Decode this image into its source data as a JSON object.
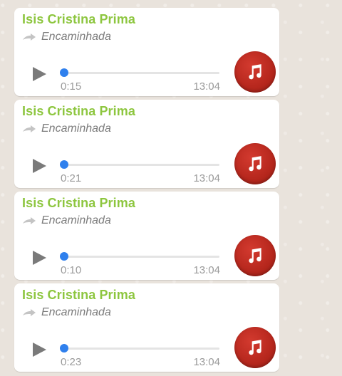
{
  "messages": [
    {
      "sender": "Isis Cristina Prima",
      "forwarded_label": "Encaminhada",
      "elapsed": "0:15",
      "timestamp": "13:04"
    },
    {
      "sender": "Isis Cristina Prima",
      "forwarded_label": "Encaminhada",
      "elapsed": "0:21",
      "timestamp": "13:04"
    },
    {
      "sender": "Isis Cristina Prima",
      "forwarded_label": "Encaminhada",
      "elapsed": "0:10",
      "timestamp": "13:04"
    },
    {
      "sender": "Isis Cristina Prima",
      "forwarded_label": "Encaminhada",
      "elapsed": "0:23",
      "timestamp": "13:04"
    }
  ],
  "colors": {
    "sender": "#8dc63f",
    "progress_knob": "#2f80ed",
    "avatar": "#c0291f",
    "background": "#ece5dd"
  },
  "icons": {
    "play": "play-icon",
    "forwarded": "forward-arrow-icon",
    "audio": "music-note-icon"
  }
}
